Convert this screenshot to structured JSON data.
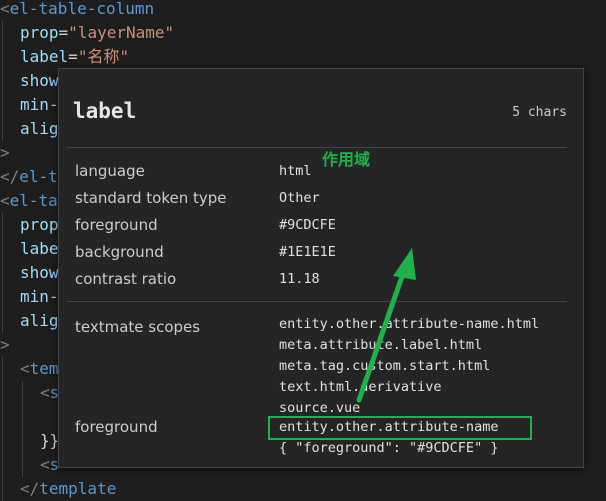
{
  "editor": {
    "lines": [
      {
        "indent": 0,
        "parts": [
          {
            "t": "<",
            "c": "punc"
          },
          {
            "t": "el-table-column",
            "c": "tag"
          }
        ]
      },
      {
        "indent": 1,
        "parts": [
          {
            "t": "prop",
            "c": "attr"
          },
          {
            "t": "=",
            "c": "plain"
          },
          {
            "t": "\"layerName\"",
            "c": "str"
          }
        ]
      },
      {
        "indent": 1,
        "parts": [
          {
            "t": "label",
            "c": "attr"
          },
          {
            "t": "=",
            "c": "plain"
          },
          {
            "t": "\"名称\"",
            "c": "str"
          }
        ]
      },
      {
        "indent": 1,
        "parts": [
          {
            "t": "show",
            "c": "attr"
          }
        ]
      },
      {
        "indent": 1,
        "parts": [
          {
            "t": "min-",
            "c": "attr"
          }
        ]
      },
      {
        "indent": 1,
        "parts": [
          {
            "t": "alig",
            "c": "attr"
          }
        ]
      },
      {
        "indent": 0,
        "parts": [
          {
            "t": ">",
            "c": "punc"
          }
        ]
      },
      {
        "indent": 0,
        "parts": [
          {
            "t": "</",
            "c": "punc"
          },
          {
            "t": "el-t",
            "c": "tag"
          }
        ]
      },
      {
        "indent": 0,
        "parts": [
          {
            "t": "<",
            "c": "punc"
          },
          {
            "t": "el-ta",
            "c": "tag"
          }
        ]
      },
      {
        "indent": 1,
        "parts": [
          {
            "t": "prop",
            "c": "attr"
          }
        ]
      },
      {
        "indent": 1,
        "parts": [
          {
            "t": "labe",
            "c": "attr"
          }
        ]
      },
      {
        "indent": 1,
        "parts": [
          {
            "t": "show",
            "c": "attr"
          }
        ]
      },
      {
        "indent": 1,
        "parts": [
          {
            "t": "min-",
            "c": "attr"
          }
        ]
      },
      {
        "indent": 1,
        "parts": [
          {
            "t": "alig",
            "c": "attr"
          }
        ]
      },
      {
        "indent": 0,
        "parts": [
          {
            "t": ">",
            "c": "punc"
          }
        ]
      },
      {
        "indent": 1,
        "parts": [
          {
            "t": "<",
            "c": "punc"
          },
          {
            "t": "tem",
            "c": "tag"
          }
        ]
      },
      {
        "indent": 2,
        "parts": [
          {
            "t": "<",
            "c": "punc"
          },
          {
            "t": "s",
            "c": "tag"
          }
        ]
      },
      {
        "indent": 2,
        "parts": []
      },
      {
        "indent": 2,
        "parts": [
          {
            "t": "}}",
            "c": "plain"
          }
        ]
      },
      {
        "indent": 2,
        "parts": [
          {
            "t": "<",
            "c": "punc"
          },
          {
            "t": "s",
            "c": "tag"
          }
        ]
      },
      {
        "indent": 1,
        "parts": [
          {
            "t": "</",
            "c": "punc"
          },
          {
            "t": "template",
            "c": "tag"
          }
        ]
      }
    ]
  },
  "hover": {
    "title": "label",
    "chars": "5 chars",
    "rows": [
      {
        "key": "language",
        "value": "html"
      },
      {
        "key": "standard token type",
        "value": "Other"
      },
      {
        "key": "foreground",
        "value": "#9CDCFE"
      },
      {
        "key": "background",
        "value": "#1E1E1E"
      },
      {
        "key": "contrast ratio",
        "value": "11.18"
      }
    ],
    "scopes_label": "textmate scopes",
    "scopes": [
      "entity.other.attribute-name.html",
      "meta.attribute.label.html",
      "meta.tag.custom.start.html",
      "text.html.derivative",
      "source.vue"
    ],
    "foreground_rule_label": "foreground",
    "foreground_rule_scope": "entity.other.attribute-name",
    "foreground_rule_json": "{ \"foreground\": \"#9CDCFE\" }"
  },
  "annotation": {
    "label": "作用域",
    "color": "#1eb34a"
  },
  "colors": {
    "tag": "#569cd6",
    "attribute": "#9cdcfe",
    "string": "#ce9178",
    "background": "#1e1e1e"
  }
}
